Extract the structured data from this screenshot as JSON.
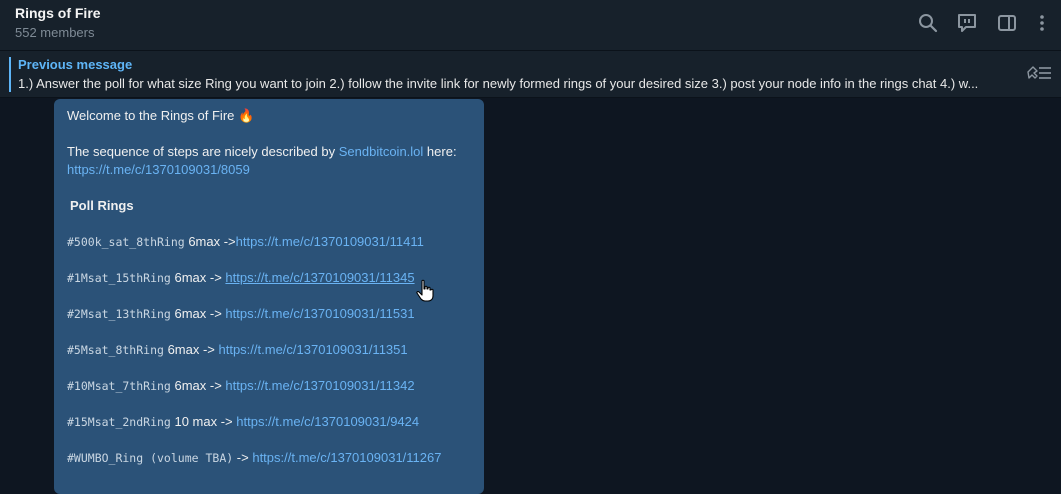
{
  "header": {
    "title": "Rings of Fire",
    "members": "552 members",
    "icons": [
      "search-icon",
      "chat-comments-icon",
      "sidebar-toggle-icon",
      "more-vertical-icon"
    ]
  },
  "pinned": {
    "title": "Previous message",
    "text": "1.) Answer the poll for what size Ring you want to join 2.) follow the invite link for newly formed rings of your desired size 3.) post your node info in the rings chat 4.) w..."
  },
  "message": {
    "welcome": "Welcome to the Rings of Fire",
    "fire_emoji": "🔥",
    "steps_prefix": "The sequence of steps are nicely described by",
    "steps_mention": "Sendbitcoin.lol",
    "steps_suffix": "here:",
    "steps_link": "https://t.me/c/1370109031/8059",
    "poll_heading": "Poll Rings",
    "rings": [
      {
        "tag": "#500k_sat_8thRing",
        "size": "6max ->",
        "link": "https://t.me/c/1370109031/11411"
      },
      {
        "tag": "#1Msat_15thRing",
        "size": "6max -> ",
        "link": "https://t.me/c/1370109031/11345"
      },
      {
        "tag": "#2Msat_13thRing",
        "size": "6max -> ",
        "link": "https://t.me/c/1370109031/11531"
      },
      {
        "tag": "#5Msat_8thRing",
        "size": "6max -> ",
        "link": "https://t.me/c/1370109031/11351"
      },
      {
        "tag": "#10Msat_7thRing",
        "size": "6max -> ",
        "link": "https://t.me/c/1370109031/11342"
      },
      {
        "tag": "#15Msat_2ndRing",
        "size": "10 max -> ",
        "link": "https://t.me/c/1370109031/9424"
      },
      {
        "tag": "#WUMBO_Ring (volume TBA)",
        "size": "-> ",
        "link": "https://t.me/c/1370109031/11267"
      }
    ]
  },
  "colors": {
    "background": "#0e1621",
    "header": "#17212b",
    "bubble": "#2b5278",
    "link": "#6ab3f3",
    "accent": "#5eb5f7"
  }
}
